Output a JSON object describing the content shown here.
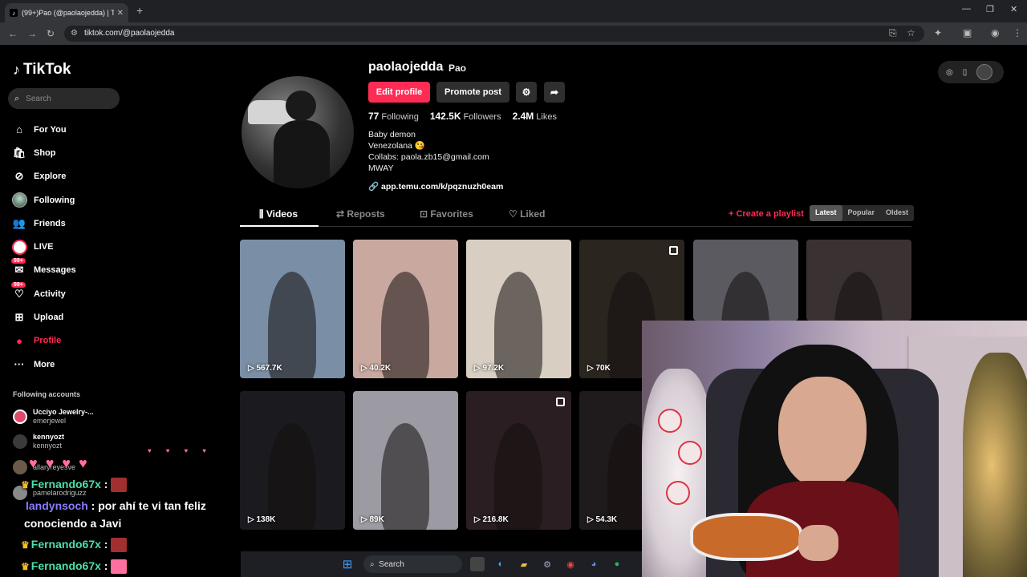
{
  "browser": {
    "tab_title": "(99+)Pao (@paolaojedda) | TikT",
    "url": "tiktok.com/@paolaojedda"
  },
  "sidebar": {
    "logo": "TikTok",
    "search_placeholder": "Search",
    "items": [
      {
        "label": "For You",
        "icon": "home-icon"
      },
      {
        "label": "Shop",
        "icon": "shop-bag-icon"
      },
      {
        "label": "Explore",
        "icon": "compass-icon"
      },
      {
        "label": "Following",
        "icon": "avatar-icon"
      },
      {
        "label": "Friends",
        "icon": "friends-icon"
      },
      {
        "label": "LIVE",
        "icon": "live-icon"
      },
      {
        "label": "Messages",
        "icon": "message-icon",
        "badge": "99+"
      },
      {
        "label": "Activity",
        "icon": "activity-icon",
        "badge": "99+"
      },
      {
        "label": "Upload",
        "icon": "plus-square-icon"
      },
      {
        "label": "Profile",
        "icon": "avatar-icon"
      },
      {
        "label": "More",
        "icon": "more-icon"
      }
    ],
    "following_header": "Following accounts",
    "accounts": [
      {
        "name": "Ucciyo Jewelry-...",
        "handle": "emerjewel"
      },
      {
        "name": "kennyozt",
        "handle": "kennyozt"
      },
      {
        "name": "",
        "handle": "allaryreyesve"
      },
      {
        "name": "",
        "handle": "pamelarodriguzz"
      }
    ]
  },
  "profile": {
    "username": "paolaojedda",
    "nickname": "Pao",
    "edit_button": "Edit profile",
    "promote_button": "Promote post",
    "following_count": "77",
    "following_label": "Following",
    "followers_count": "142.5K",
    "followers_label": "Followers",
    "likes_count": "2.4M",
    "likes_label": "Likes",
    "bio": [
      "Baby demon",
      "Venezolana 😘",
      "Collabs: paola.zb15@gmail.com",
      "MWAY"
    ],
    "link": "app.temu.com/k/pqznuzh0eam"
  },
  "tabs": [
    "Videos",
    "Reposts",
    "Favorites",
    "Liked"
  ],
  "create_playlist": "Create a playlist",
  "sort_options": [
    "Latest",
    "Popular",
    "Oldest"
  ],
  "videos": [
    {
      "views": "567.7K",
      "bg": "#7a8fa5"
    },
    {
      "views": "40.2K",
      "bg": "#c9a8a0"
    },
    {
      "views": "97.2K",
      "bg": "#d8cfc2"
    },
    {
      "views": "70K",
      "bg": "#2b2520"
    },
    {
      "views": "",
      "bg": "#5a5a60"
    },
    {
      "views": "",
      "bg": "#3a3232"
    },
    {
      "views": "138K",
      "bg": "#1b1b1f"
    },
    {
      "views": "89K",
      "bg": "#9c9ba3"
    },
    {
      "views": "216.8K",
      "bg": "#2a1e22"
    },
    {
      "views": "54.3K",
      "bg": "#1f1a1c"
    }
  ],
  "chat": [
    {
      "user": "Fernando67x",
      "sep": " :",
      "text": ""
    },
    {
      "user": "landynsoch",
      "sep": " :",
      "text": "por ahí te vi tan feliz"
    },
    {
      "user": "",
      "sep": "",
      "text": "conociendo a Javi"
    },
    {
      "user": "Fernando67x",
      "sep": " :",
      "text": ""
    },
    {
      "user": "Fernando67x",
      "sep": " :",
      "text": ""
    }
  ],
  "taskbar": {
    "search_placeholder": "Search"
  },
  "colors": {
    "brand": "#fe2c55",
    "chat_user1": "#4ce0a8",
    "chat_user2": "#8a7dff"
  }
}
